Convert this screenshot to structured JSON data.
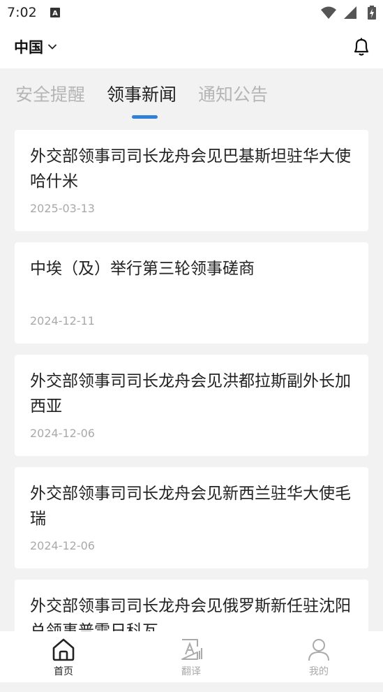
{
  "status_bar": {
    "time": "7:02",
    "notification_icon": "A"
  },
  "header": {
    "region": "中国",
    "icons": [
      "chevron-down-icon",
      "bell-icon"
    ]
  },
  "tabs": [
    {
      "label": "安全提醒",
      "active": false
    },
    {
      "label": "领事新闻",
      "active": true
    },
    {
      "label": "通知公告",
      "active": false
    }
  ],
  "news": [
    {
      "title": "外交部领事司司长龙舟会见巴基斯坦驻华大使哈什米",
      "date": "2025-03-13"
    },
    {
      "title": "中埃（及）举行第三轮领事磋商",
      "date": "2024-12-11"
    },
    {
      "title": "外交部领事司司长龙舟会见洪都拉斯副外长加西亚",
      "date": "2024-12-06"
    },
    {
      "title": "外交部领事司司长龙舟会见新西兰驻华大使毛瑞",
      "date": "2024-12-06"
    },
    {
      "title": "外交部领事司司长龙舟会见俄罗斯新任驻沈阳总领事普雷日科瓦",
      "date": ""
    }
  ],
  "bottom_nav": [
    {
      "label": "首页",
      "icon": "home-icon",
      "active": true
    },
    {
      "label": "翻译",
      "icon": "translate-icon",
      "active": false
    },
    {
      "label": "我的",
      "icon": "user-icon",
      "active": false
    }
  ],
  "colors": {
    "accent": "#2f80d8",
    "background": "#f2f2f2",
    "card": "#ffffff",
    "inactive_text": "#b5b5b5"
  }
}
